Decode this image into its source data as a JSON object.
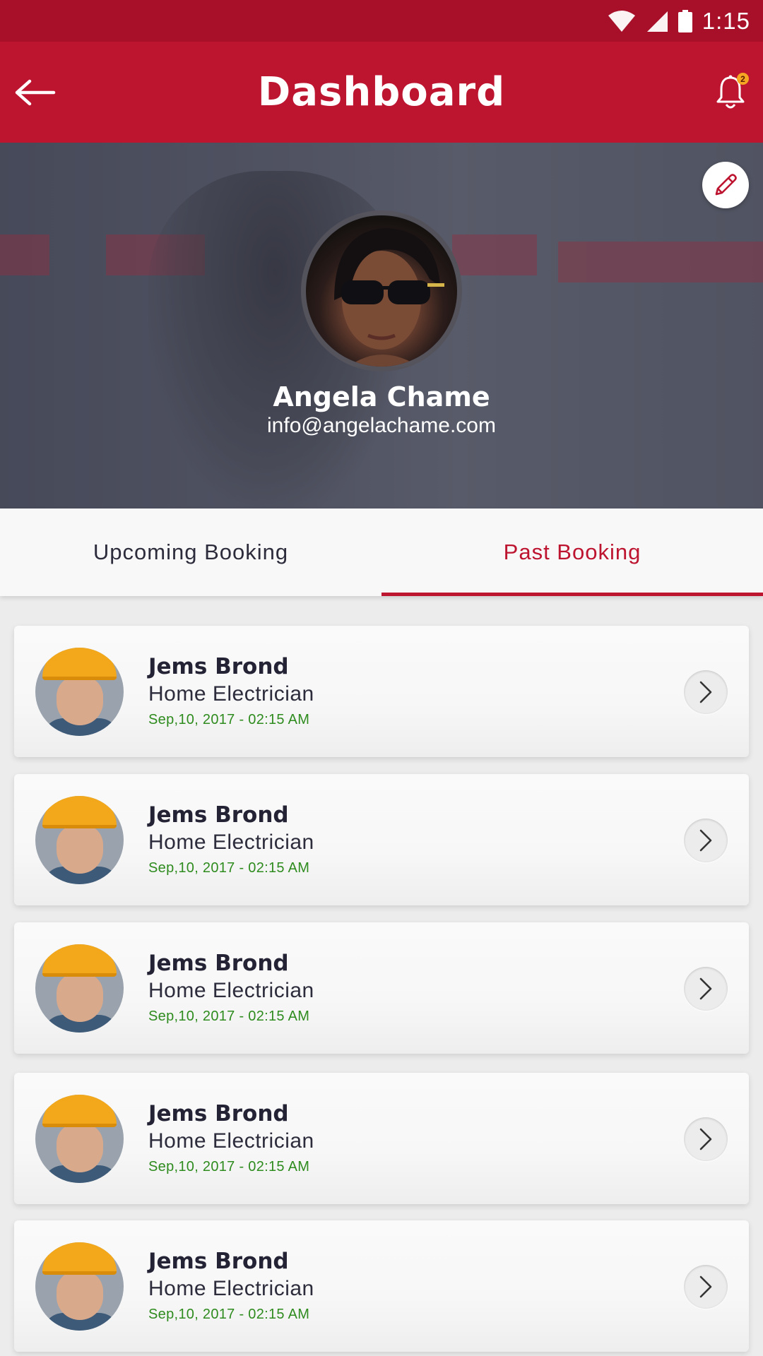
{
  "status_bar": {
    "time": "1:15",
    "icons": [
      "wifi-icon",
      "signal-icon",
      "battery-icon"
    ]
  },
  "app_bar": {
    "title": "Dashboard",
    "back_icon": "back-arrow-icon",
    "notification_icon": "bell-icon",
    "notification_count": "2"
  },
  "profile": {
    "name": "Angela Chame",
    "email": "info@angelachame.com",
    "edit_icon": "pencil-icon"
  },
  "tabs": [
    {
      "label": "Upcoming Booking",
      "active": false
    },
    {
      "label": "Past Booking",
      "active": true
    }
  ],
  "bookings": [
    {
      "name": "Jems Brond",
      "role": "Home Electrician",
      "datetime": "Sep,10, 2017 - 02:15 AM"
    },
    {
      "name": "Jems Brond",
      "role": "Home Electrician",
      "datetime": "Sep,10, 2017 - 02:15 AM"
    },
    {
      "name": "Jems Brond",
      "role": "Home Electrician",
      "datetime": "Sep,10, 2017 - 02:15 AM"
    },
    {
      "name": "Jems Brond",
      "role": "Home Electrician",
      "datetime": "Sep,10, 2017 - 02:15 AM"
    },
    {
      "name": "Jems Brond",
      "role": "Home Electrician",
      "datetime": "Sep,10, 2017 - 02:15 AM"
    }
  ],
  "colors": {
    "primary": "#bd1430",
    "status_bar": "#a8102a",
    "date_text": "#2e8b1e",
    "notification_badge": "#f5a623"
  }
}
